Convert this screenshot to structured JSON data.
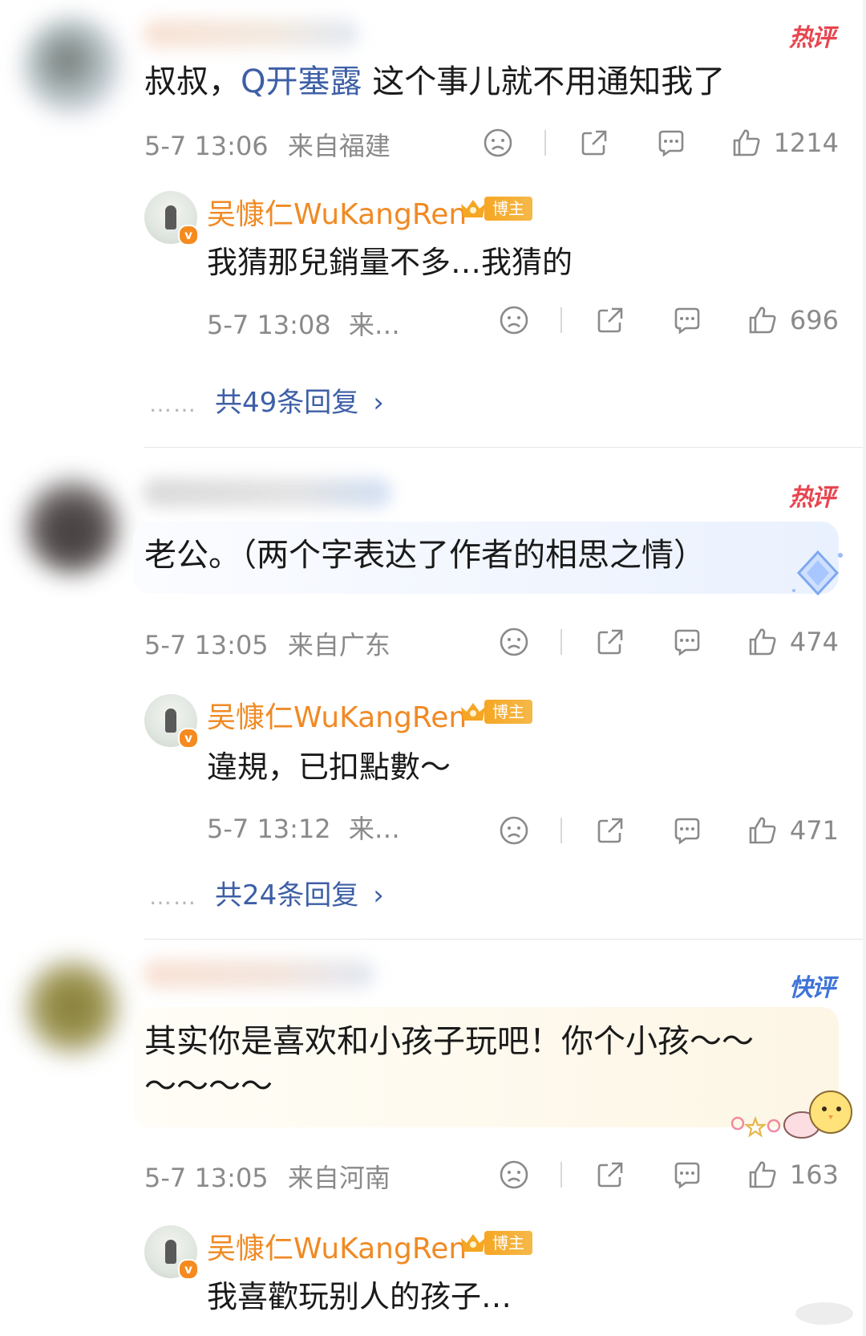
{
  "comments": [
    {
      "badge": "热评",
      "text_parts": [
        "叔叔，",
        "Q开塞露",
        " 这个事儿就不用通知我了"
      ],
      "time": "5-7 13:06",
      "location": "来自福建",
      "likes": "1214",
      "reply": {
        "name": "吴慷仁WuKangRen",
        "tag": "博主",
        "text": "我猜那兒銷量不多…我猜的",
        "time": "5-7 13:08",
        "location": "来…",
        "likes": "696"
      },
      "more_replies": "共49条回复"
    },
    {
      "badge": "热评",
      "text": "老公。（两个字表达了作者的相思之情）",
      "time": "5-7 13:05",
      "location": "来自广东",
      "likes": "474",
      "reply": {
        "name": "吴慷仁WuKangRen",
        "tag": "博主",
        "text": "違規，已扣點數～",
        "time": "5-7 13:12",
        "location": "来…",
        "likes": "471"
      },
      "more_replies": "共24条回复"
    },
    {
      "badge": "快评",
      "text_line1": "其实你是喜欢和小孩子玩吧！你个小孩～～",
      "text_line2": "～～～～",
      "time": "5-7 13:05",
      "location": "来自河南",
      "likes": "163",
      "reply": {
        "name": "吴慷仁WuKangRen",
        "tag": "博主",
        "text": "我喜歡玩别人的孩子…"
      }
    }
  ],
  "icons": {
    "dislike": "sad-face-icon",
    "share": "share-icon",
    "comment": "comment-icon",
    "like": "thumbs-up-icon",
    "chevron": "›",
    "dots": "……"
  },
  "colors": {
    "link": "#3d5fa6",
    "author": "#f08a24",
    "hot": "#e8454f",
    "fast": "#3f74d8",
    "meta": "#8a8a8a"
  }
}
